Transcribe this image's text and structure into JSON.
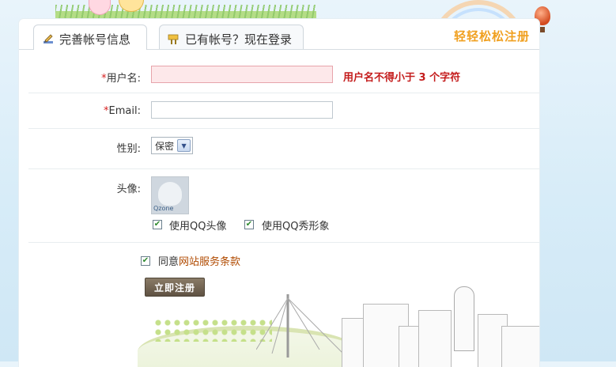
{
  "tabs": {
    "active_label": "完善帐号信息",
    "inactive_label": "已有帐号？现在登录"
  },
  "slogan": "轻轻松松注册",
  "form": {
    "username": {
      "required_mark": "*",
      "label": "用户名:",
      "value": "",
      "error": "用户名不得小于 3 个字符"
    },
    "email": {
      "required_mark": "*",
      "label": "Email:",
      "value": ""
    },
    "gender": {
      "label": "性别:",
      "selected": "保密"
    },
    "avatar": {
      "label": "头像:",
      "badge_text": "Qzone",
      "use_qq_avatar_label": "使用QQ头像",
      "use_qq_show_label": "使用QQ秀形象",
      "use_qq_avatar_checked": true,
      "use_qq_show_checked": true
    },
    "agreement": {
      "prefix": "同意",
      "link_text": "网站服务条款",
      "checked": true
    },
    "submit_label": "立即注册"
  },
  "colors": {
    "error": "#c41c1c",
    "required": "#d61f1f",
    "slogan": "#f0a020",
    "link": "#b04a00",
    "submit_bg": "#6f614f"
  },
  "icons": {
    "active_tab": "pencil-icon",
    "inactive_tab": "sign-icon",
    "checkbox": "checkmark-icon",
    "select": "chevron-down-icon"
  }
}
